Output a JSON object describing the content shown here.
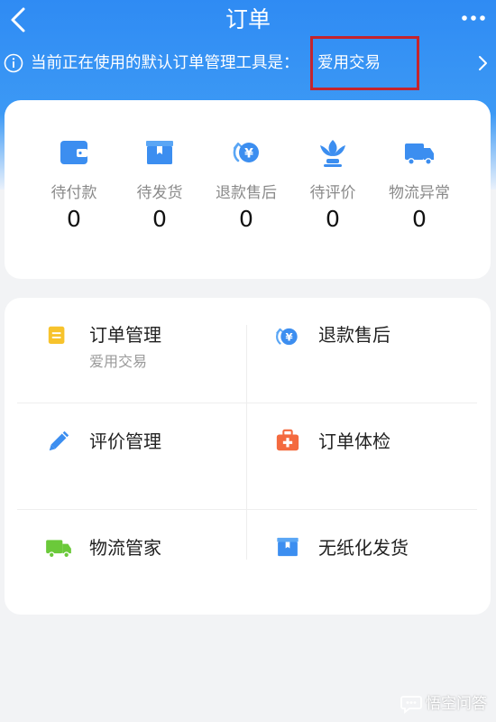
{
  "nav": {
    "title": "订单"
  },
  "notice": {
    "text": "当前正在使用的默认订单管理工具是：",
    "value": "爱用交易"
  },
  "status": [
    {
      "label": "待付款",
      "count": "0",
      "icon": "wallet-icon"
    },
    {
      "label": "待发货",
      "count": "0",
      "icon": "box-icon"
    },
    {
      "label": "退款售后",
      "count": "0",
      "icon": "yuan-refund-icon"
    },
    {
      "label": "待评价",
      "count": "0",
      "icon": "flower-icon"
    },
    {
      "label": "物流异常",
      "count": "0",
      "icon": "truck-icon"
    }
  ],
  "tools": [
    {
      "name": "订单管理",
      "sub": "爱用交易",
      "icon": "list-icon"
    },
    {
      "name": "退款售后",
      "sub": "",
      "icon": "yuan-refund-icon"
    },
    {
      "name": "评价管理",
      "sub": "",
      "icon": "pencil-icon"
    },
    {
      "name": "订单体检",
      "sub": "",
      "icon": "medkit-icon"
    },
    {
      "name": "物流管家",
      "sub": "",
      "icon": "truck-icon"
    },
    {
      "name": "无纸化发货",
      "sub": "",
      "icon": "box-icon"
    }
  ],
  "watermark": {
    "text": "悟空问答"
  },
  "colors": {
    "header": "#2f8bf3",
    "icon_blue": "#3c8ef0",
    "icon_yellow": "#f7c32c",
    "icon_orange": "#f46a3f",
    "icon_green": "#6bc93a",
    "highlight_box": "#c4242d"
  }
}
